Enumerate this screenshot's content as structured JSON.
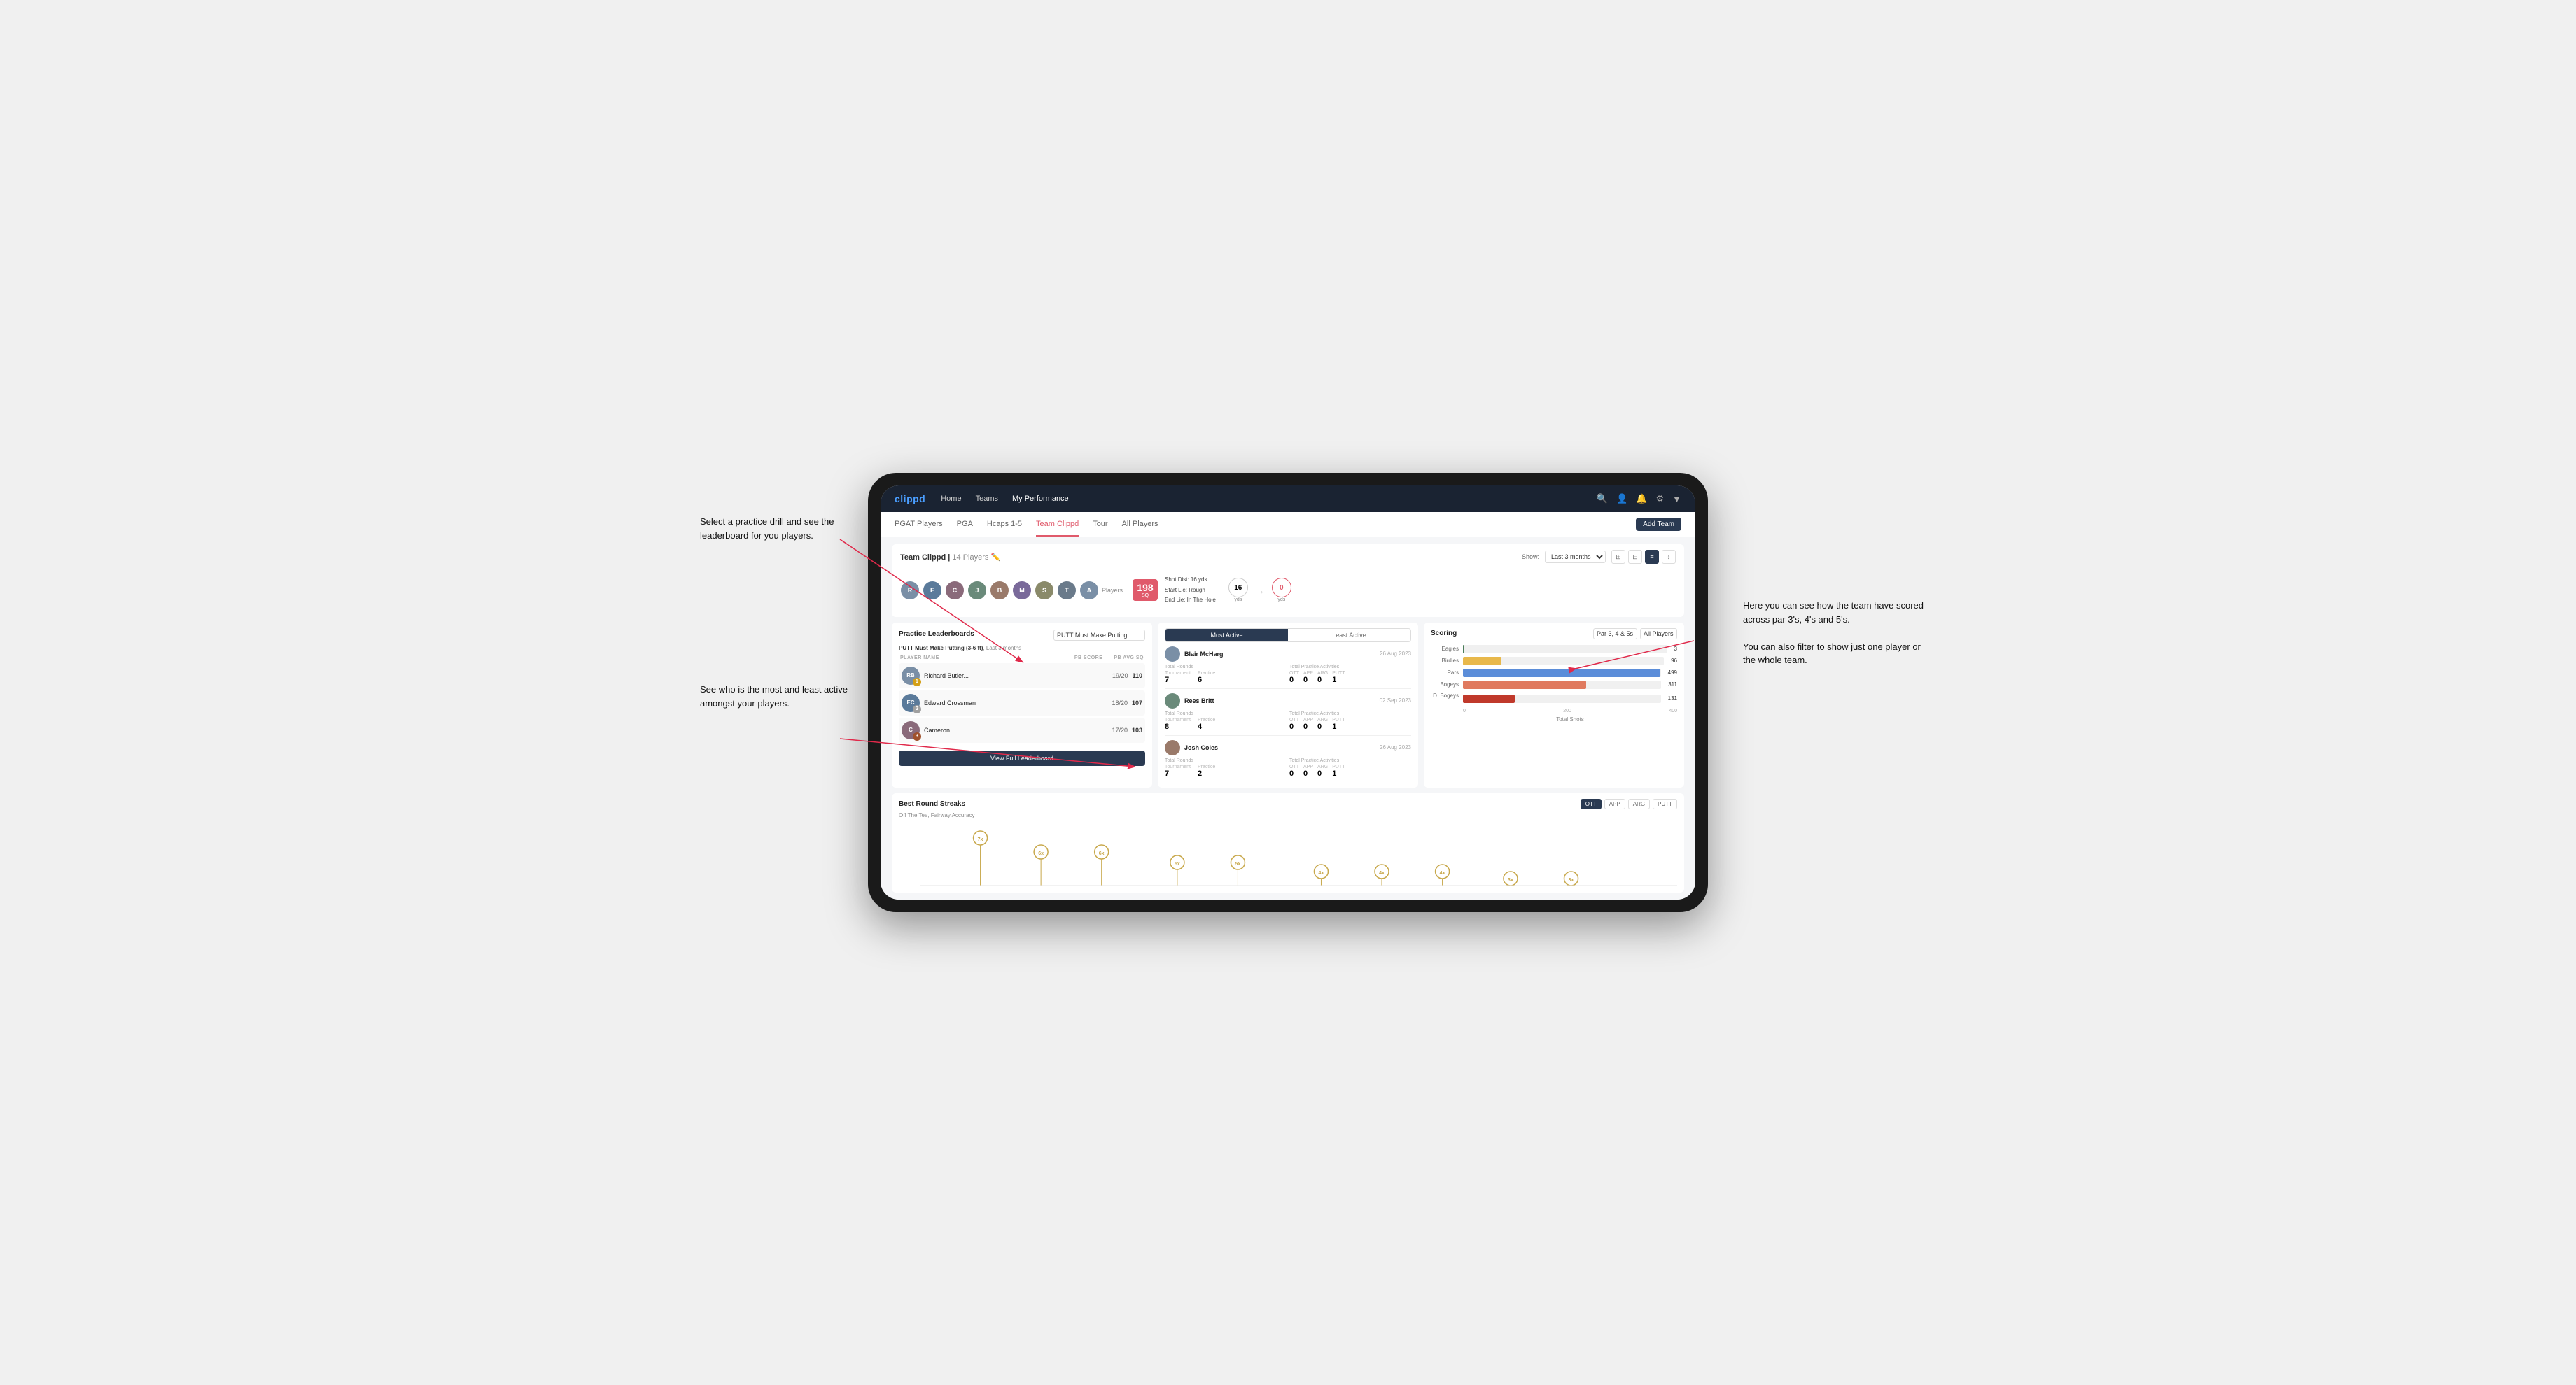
{
  "brand": "clippd",
  "navbar": {
    "links": [
      "Home",
      "Teams",
      "My Performance"
    ],
    "icons": [
      "search",
      "person",
      "bell",
      "settings",
      "profile"
    ]
  },
  "subnav": {
    "links": [
      "PGAT Players",
      "PGA",
      "Hcaps 1-5",
      "Team Clippd",
      "Tour",
      "All Players"
    ],
    "active": "Team Clippd",
    "add_button": "Add Team"
  },
  "team_header": {
    "title": "Team Clippd",
    "count": "14 Players",
    "show_label": "Show:",
    "show_value": "Last 3 months",
    "views": [
      "grid-2",
      "grid-3",
      "list",
      "sort"
    ]
  },
  "players_label": "Players",
  "shot_info": {
    "badge": "198",
    "badge_sub": "SQ",
    "details": [
      "Shot Dist: 16 yds",
      "Start Lie: Rough",
      "End Lie: In The Hole"
    ],
    "yds_left": "16",
    "yds_right": "0",
    "yds_label": "yds"
  },
  "practice_leaderboards": {
    "title": "Practice Leaderboards",
    "selected_drill": "PUTT Must Make Putting...",
    "subtitle": "PUTT Must Make Putting (3-6 ft), Last 3 months",
    "columns": [
      "PLAYER NAME",
      "PB SCORE",
      "PB AVG SQ"
    ],
    "rows": [
      {
        "name": "Richard Butler...",
        "score": "19/20",
        "avg": "110",
        "medal": "gold",
        "rank": "1"
      },
      {
        "name": "Edward Crossman",
        "score": "18/20",
        "avg": "107",
        "medal": "silver",
        "rank": "2"
      },
      {
        "name": "Cameron...",
        "score": "17/20",
        "avg": "103",
        "medal": "bronze",
        "rank": "3"
      }
    ],
    "view_button": "View Full Leaderboard"
  },
  "activity": {
    "tabs": [
      "Most Active",
      "Least Active"
    ],
    "active_tab": "Most Active",
    "cards": [
      {
        "name": "Blair McHarg",
        "date": "26 Aug 2023",
        "total_rounds_label": "Total Rounds",
        "tournament": "7",
        "practice": "6",
        "total_practice_label": "Total Practice Activities",
        "ott": "0",
        "app": "0",
        "arg": "0",
        "putt": "1"
      },
      {
        "name": "Rees Britt",
        "date": "02 Sep 2023",
        "total_rounds_label": "Total Rounds",
        "tournament": "8",
        "practice": "4",
        "total_practice_label": "Total Practice Activities",
        "ott": "0",
        "app": "0",
        "arg": "0",
        "putt": "1"
      },
      {
        "name": "Josh Coles",
        "date": "26 Aug 2023",
        "total_rounds_label": "Total Rounds",
        "tournament": "7",
        "practice": "2",
        "total_practice_label": "Total Practice Activities",
        "ott": "0",
        "app": "0",
        "arg": "0",
        "putt": "1"
      }
    ]
  },
  "scoring": {
    "title": "Scoring",
    "par_filter": "Par 3, 4 & 5s",
    "player_filter": "All Players",
    "bars": [
      {
        "label": "Eagles",
        "value": 3,
        "max": 500,
        "type": "eagles"
      },
      {
        "label": "Birdies",
        "value": 96,
        "max": 500,
        "type": "birdies"
      },
      {
        "label": "Pars",
        "value": 499,
        "max": 500,
        "type": "pars"
      },
      {
        "label": "Bogeys",
        "value": 311,
        "max": 500,
        "type": "bogeys"
      },
      {
        "label": "D. Bogeys +",
        "value": 131,
        "max": 500,
        "type": "dbogeys"
      }
    ],
    "x_axis": [
      "0",
      "200",
      "400"
    ],
    "x_label": "Total Shots"
  },
  "streaks": {
    "title": "Best Round Streaks",
    "tabs": [
      "OTT",
      "APP",
      "ARG",
      "PUTT"
    ],
    "active_tab": "OTT",
    "subtitle": "Off The Tee, Fairway Accuracy",
    "points": [
      {
        "x": 8,
        "y": 20,
        "label": "7x"
      },
      {
        "x": 16,
        "y": 40,
        "label": "6x"
      },
      {
        "x": 24,
        "y": 40,
        "label": "6x"
      },
      {
        "x": 34,
        "y": 55,
        "label": "5x"
      },
      {
        "x": 42,
        "y": 55,
        "label": "5x"
      },
      {
        "x": 53,
        "y": 68,
        "label": "4x"
      },
      {
        "x": 61,
        "y": 68,
        "label": "4x"
      },
      {
        "x": 69,
        "y": 68,
        "label": "4x"
      },
      {
        "x": 78,
        "y": 78,
        "label": "3x"
      },
      {
        "x": 86,
        "y": 78,
        "label": "3x"
      }
    ]
  },
  "annotations": {
    "left_top": "Select a practice drill and see the leaderboard for you players.",
    "left_bottom": "See who is the most and least active amongst your players.",
    "right": "Here you can see how the team have scored across par 3's, 4's and 5's.\n\nYou can also filter to show just one player or the whole team."
  },
  "all_players_label": "AIl Players"
}
